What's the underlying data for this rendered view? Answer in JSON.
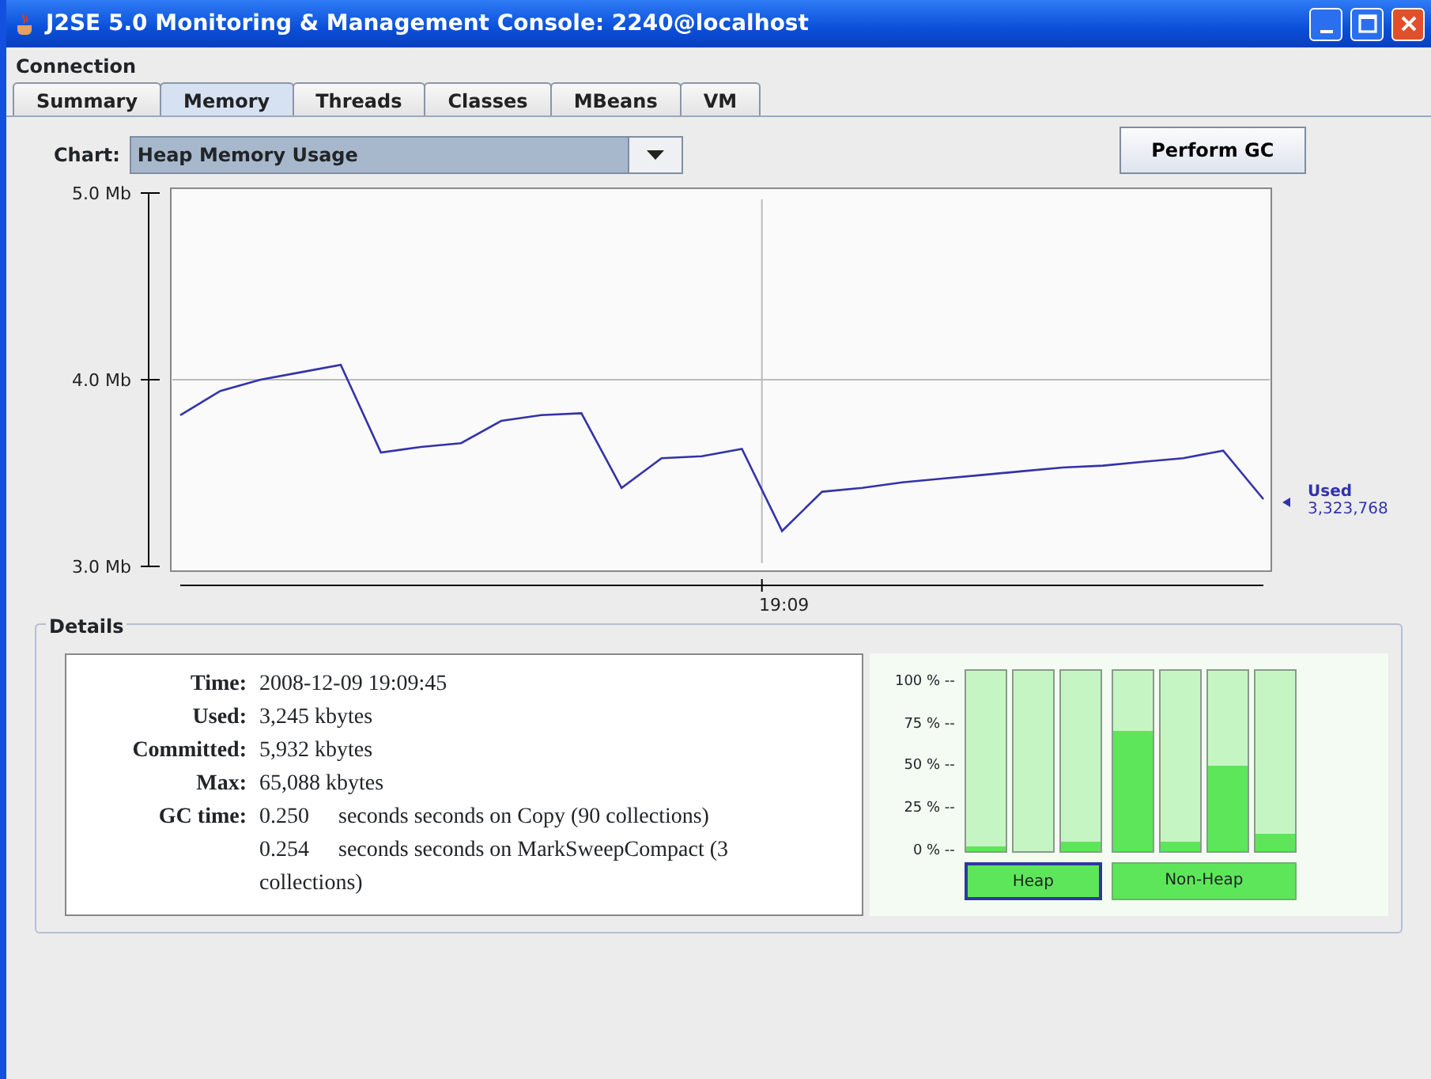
{
  "window": {
    "title": "J2SE 5.0 Monitoring & Management Console: 2240@localhost"
  },
  "menu": [
    {
      "label": "Connection"
    }
  ],
  "tabs": [
    {
      "label": "Summary",
      "selected": false
    },
    {
      "label": "Memory",
      "selected": true
    },
    {
      "label": "Threads",
      "selected": false
    },
    {
      "label": "Classes",
      "selected": false
    },
    {
      "label": "MBeans",
      "selected": false
    },
    {
      "label": "VM",
      "selected": false
    }
  ],
  "chart_selector": {
    "label": "Chart:",
    "value": "Heap Memory Usage"
  },
  "perform_gc_button": "Perform GC",
  "memory_chart": {
    "chart_data": {
      "type": "line",
      "series": [
        {
          "name": "Used",
          "color": "#3333aa",
          "values": [
            3.81,
            3.94,
            4.0,
            4.04,
            4.08,
            3.61,
            3.64,
            3.66,
            3.78,
            3.81,
            3.82,
            3.42,
            3.58,
            3.59,
            3.63,
            3.19,
            3.4,
            3.42,
            3.45,
            3.47,
            3.49,
            3.51,
            3.53,
            3.54,
            3.56,
            3.58,
            3.62,
            3.36
          ]
        }
      ],
      "ylim": [
        3,
        5
      ],
      "annotations": [
        "19:09"
      ],
      "yticks": [
        {
          "value": 3,
          "label": "3.0 Mb"
        },
        {
          "value": 4,
          "label": "4.0 Mb"
        },
        {
          "value": 5,
          "label": "5.0 Mb"
        }
      ]
    },
    "legend_value": "3,323,768"
  },
  "details": {
    "title": "Details",
    "rows": [
      {
        "label": "Time:",
        "value": "2008-12-09 19:09:45"
      },
      {
        "label": "Used:",
        "value": "3,245 kbytes"
      },
      {
        "label": "Committed:",
        "value": "5,932 kbytes"
      },
      {
        "label": "Max:",
        "value": "65,088 kbytes"
      }
    ],
    "gc_label": "GC time:",
    "gc": [
      {
        "time": "0.250",
        "text": "seconds seconds on Copy (90 collections)"
      },
      {
        "time": "0.254",
        "text": "seconds seconds on MarkSweepCompact (3 collections)"
      }
    ]
  },
  "pools": {
    "scale": [
      "100 % --",
      "75 % --",
      "50 % --",
      "25 % --",
      "0 % --"
    ],
    "groups": [
      {
        "label": "Heap",
        "selected": true,
        "bars": [
          {
            "level": 0.03
          },
          {
            "level": 0
          },
          {
            "level": 0.05
          }
        ]
      },
      {
        "label": "Non-Heap",
        "selected": false,
        "bars": [
          {
            "level": 0.67
          },
          {
            "level": 0.05
          },
          {
            "level": 0.47
          },
          {
            "level": 0.1
          }
        ]
      }
    ]
  }
}
